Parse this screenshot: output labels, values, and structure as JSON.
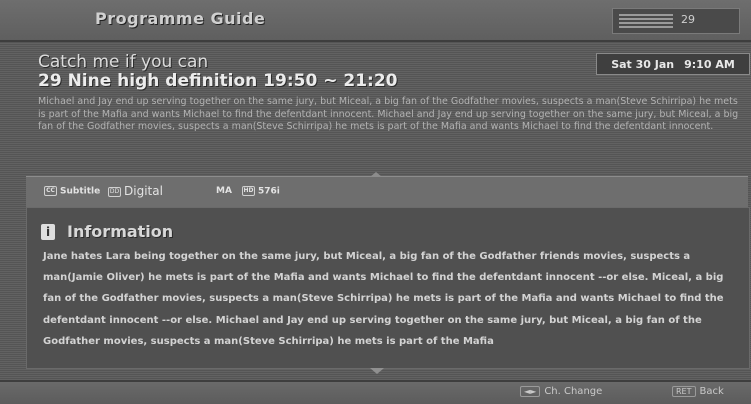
{
  "header": {
    "title": "Programme Guide",
    "signal_value": "29"
  },
  "programme": {
    "title": "Catch me if you can",
    "channel_line": "29 Nine high definition   19:50 ~ 21:20",
    "synopsis": "Michael and Jay end up serving together on the same jury, but Miceal, a big fan of the Godfather movies, suspects a man(Steve Schirripa) he mets is part of the Mafia and wants Michael to find the defentdant innocent. Michael and Jay end up serving together on the same jury, but Miceal, a big fan of the Godfather movies, suspects a man(Steve Schirripa) he mets is part of the Mafia and wants Michael to find the defentdant innocent."
  },
  "datetime": {
    "date": "Sat 30 Jan",
    "time": "9:10 AM"
  },
  "features": {
    "subtitle_icon": "CC",
    "subtitle": "Subtitle",
    "digital_icon": "DD",
    "digital": "Digital",
    "rating": "MA",
    "resolution_icon": "HD",
    "resolution": "576i"
  },
  "information": {
    "title": "Information",
    "icon": "i",
    "body": "Jane hates Lara being together on the same jury, but Miceal, a big fan of the Godfather friends movies, suspects a man(Jamie Oliver) he mets is part of the Mafia and wants Michael to find the defentdant innocent --or else. Miceal, a big fan of the Godfather movies, suspects a  man(Steve Schirripa) he mets is part  of the Mafia and wants Michael to find the defentdant innocent --or else. Michael and Jay end up serving together on the same jury, but Miceal, a big fan of the Godfather movies, suspects a man(Steve Schirripa) he mets is part of the Mafia"
  },
  "footer": {
    "change_key": "◄►",
    "change_label": "Ch. Change",
    "back_key": "RET",
    "back_label": "Back"
  },
  "icons": {
    "info": "info-icon",
    "subtitle": "subtitle-icon",
    "digital": "dolby-digital-icon",
    "hd": "hd-icon",
    "scroll_down": "chevron-down-icon"
  }
}
